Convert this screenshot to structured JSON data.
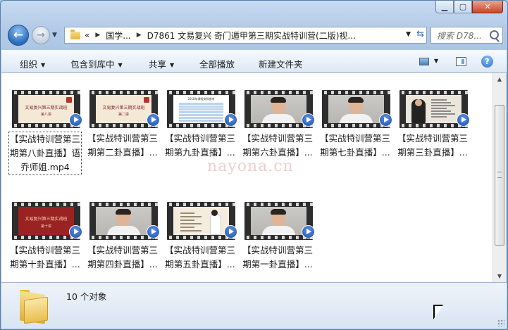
{
  "window": {
    "caption_buttons": [
      "minimize",
      "maximize",
      "close"
    ]
  },
  "address": {
    "prefix": "«",
    "crumbs": [
      "国学...",
      "D7861 文易复兴 奇门遁甲第三期实战特训营(二版)视..."
    ]
  },
  "search": {
    "placeholder": "搜索 D78..."
  },
  "toolbar": {
    "organize": "组织",
    "include_library": "包含到库中",
    "share": "共享",
    "play_all": "全部播放",
    "new_folder": "新建文件夹"
  },
  "files": [
    {
      "label": "【实战特训营第三期第八卦直播】语乔师姐.mp4",
      "thumb": "doc",
      "selected": true,
      "title": "文易复兴第三期实战班",
      "sub": "第八讲"
    },
    {
      "label": "【实战特训营第三期第二卦直播】...",
      "thumb": "doc",
      "title": "文易复兴第三期实战班",
      "sub": "第二讲"
    },
    {
      "label": "【实战特训营第三期第九卦直播】...",
      "thumb": "table",
      "title": "2018年课程安排参考"
    },
    {
      "label": "【实战特训营第三期第六卦直播】...",
      "thumb": "person"
    },
    {
      "label": "【实战特训营第三期第七卦直播】...",
      "thumb": "person"
    },
    {
      "label": "【实战特训营第三期第三卦直播】...",
      "thumb": "slide"
    },
    {
      "label": "【实战特训营第三期第十卦直播】...",
      "thumb": "red",
      "title": "文易复兴第三期实战班",
      "sub": "第十讲"
    },
    {
      "label": "【实战特训营第三期第四卦直播】...",
      "thumb": "person"
    },
    {
      "label": "【实战特训营第三期第五卦直播】...",
      "thumb": "lady"
    },
    {
      "label": "【实战特训营第三期第一卦直播】...",
      "thumb": "person"
    }
  ],
  "status": {
    "count_text": "10 个对象"
  },
  "watermark": "nayona.cn"
}
